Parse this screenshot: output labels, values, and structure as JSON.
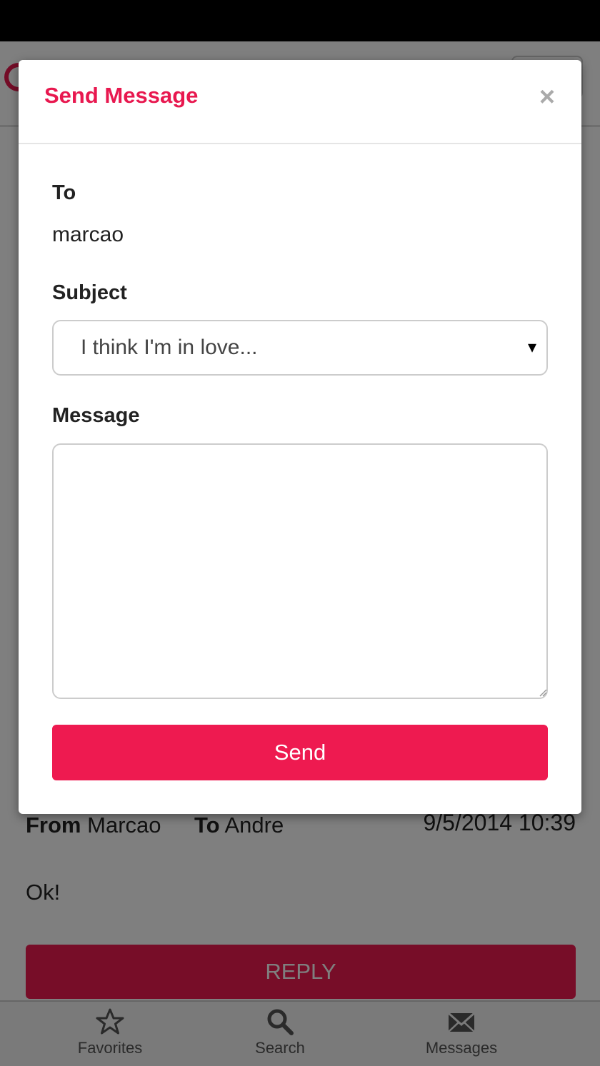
{
  "modal": {
    "title": "Send Message",
    "close_symbol": "×",
    "to_label": "To",
    "to_value": "marcao",
    "subject_label": "Subject",
    "subject_value": "I think I'm in love...",
    "subject_arrow": "▾",
    "message_label": "Message",
    "message_value": "",
    "send_label": "Send"
  },
  "message": {
    "from_label": "From",
    "from_value": "Marcao",
    "to_label": "To",
    "to_value": "Andre",
    "date": "9/5/2014 10:39",
    "body": "Ok!",
    "reply_label": "REPLY"
  },
  "bottom_nav": {
    "items": [
      {
        "label": "Favorites",
        "icon": "star-icon"
      },
      {
        "label": "Search",
        "icon": "search-icon"
      },
      {
        "label": "Messages",
        "icon": "envelope-icon"
      }
    ]
  },
  "colors": {
    "accent": "#ee1a50",
    "title": "#e8184f"
  }
}
